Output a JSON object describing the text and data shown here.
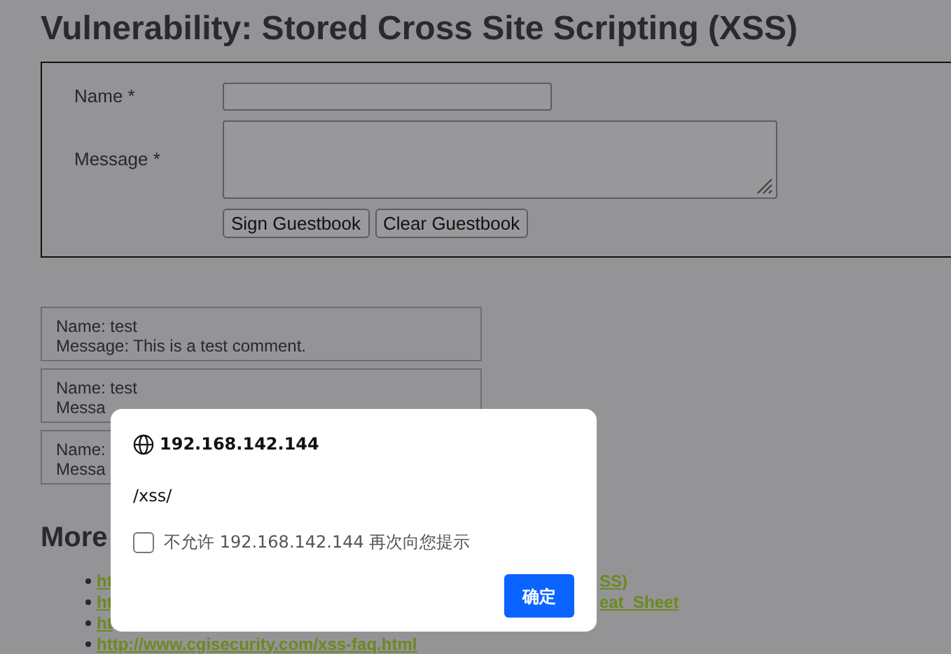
{
  "page": {
    "title": "Vulnerability: Stored Cross Site Scripting (XSS)",
    "form": {
      "fields": [
        {
          "label": "Name *",
          "kind": "input"
        },
        {
          "label": "Message *",
          "kind": "textarea"
        }
      ],
      "buttons": [
        "Sign Guestbook",
        "Clear Guestbook"
      ]
    },
    "entries": [
      {
        "lines": [
          "Name: test",
          "Message: This is a test comment."
        ]
      },
      {
        "lines": [
          "Name: test",
          "Messa"
        ]
      },
      {
        "lines": [
          "Name:",
          "Messa"
        ]
      }
    ],
    "more_heading": "More",
    "links": [
      {
        "parts": [
          "ht",
          "SS)"
        ]
      },
      {
        "parts": [
          "ht",
          "eat_Sheet"
        ]
      },
      {
        "parts": [
          "ht"
        ]
      },
      {
        "parts": [
          "http://www.cgisecurity.com/xss-faq.html"
        ]
      }
    ]
  },
  "dialog": {
    "title": "192.168.142.144",
    "message": "/xss/",
    "checkbox": {
      "label": "不允许 192.168.142.144 再次向您提示",
      "checked": false
    },
    "ok_button": "确定"
  }
}
